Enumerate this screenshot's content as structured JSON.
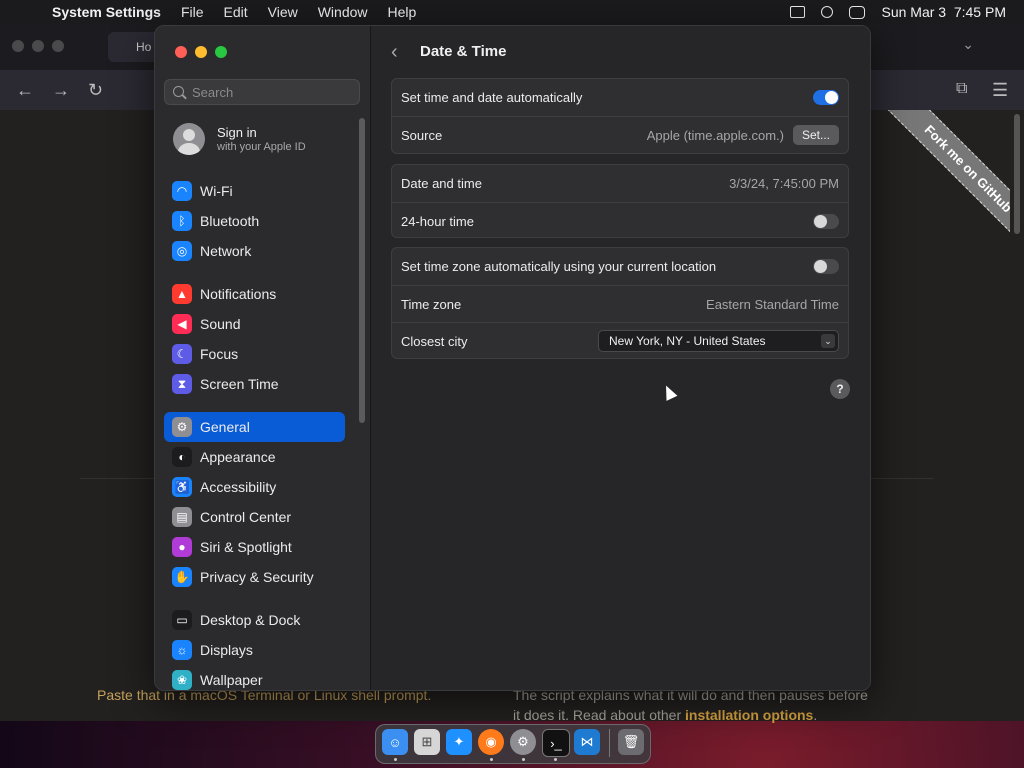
{
  "menubar": {
    "app": "System Settings",
    "items": [
      "File",
      "Edit",
      "View",
      "Window",
      "Help"
    ],
    "clock": "Sun Mar 3  7:45 PM"
  },
  "browser": {
    "tab_label": "Ho",
    "footer_left": "Paste that in a macOS Terminal or Linux shell prompt.",
    "footer_right_1": "The script explains what it will do and then pauses before",
    "footer_right_2a": "it does it. Read about other ",
    "footer_right_2b": "installation options",
    "footer_right_2c": ".",
    "ribbon": "Fork me on GitHub"
  },
  "sidebar": {
    "search_placeholder": "Search",
    "signin_title": "Sign in",
    "signin_sub": "with your Apple ID",
    "items": [
      {
        "label": "Wi-Fi",
        "icon": "wifi-icon",
        "color": "#1a84ff",
        "glyph": "◠"
      },
      {
        "label": "Bluetooth",
        "icon": "bluetooth-icon",
        "color": "#1a84ff",
        "glyph": "ᛒ"
      },
      {
        "label": "Network",
        "icon": "network-globe-icon",
        "color": "#1a84ff",
        "glyph": "◎"
      },
      {
        "label": "Notifications",
        "icon": "notifications-icon",
        "color": "#ff3b30",
        "glyph": "▲"
      },
      {
        "label": "Sound",
        "icon": "sound-icon",
        "color": "#ff2d55",
        "glyph": "◀"
      },
      {
        "label": "Focus",
        "icon": "focus-moon-icon",
        "color": "#5e5ce6",
        "glyph": "☾"
      },
      {
        "label": "Screen Time",
        "icon": "hourglass-icon",
        "color": "#5e5ce6",
        "glyph": "⧗"
      },
      {
        "label": "General",
        "icon": "gear-icon",
        "color": "#8e8e93",
        "glyph": "⚙"
      },
      {
        "label": "Appearance",
        "icon": "appearance-icon",
        "color": "#1c1c1e",
        "glyph": "◐"
      },
      {
        "label": "Accessibility",
        "icon": "accessibility-icon",
        "color": "#1a84ff",
        "glyph": "♿"
      },
      {
        "label": "Control Center",
        "icon": "control-center-icon",
        "color": "#8e8e93",
        "glyph": "▤"
      },
      {
        "label": "Siri & Spotlight",
        "icon": "siri-icon",
        "color": "#b03bd6",
        "glyph": "●"
      },
      {
        "label": "Privacy & Security",
        "icon": "privacy-hand-icon",
        "color": "#1a84ff",
        "glyph": "✋"
      },
      {
        "label": "Desktop & Dock",
        "icon": "desktop-dock-icon",
        "color": "#1c1c1e",
        "glyph": "▭"
      },
      {
        "label": "Displays",
        "icon": "displays-icon",
        "color": "#1a84ff",
        "glyph": "☼"
      },
      {
        "label": "Wallpaper",
        "icon": "wallpaper-icon",
        "color": "#30b0c7",
        "glyph": "❀"
      }
    ]
  },
  "page": {
    "title": "Date & Time",
    "set_auto_label": "Set time and date automatically",
    "source_label": "Source",
    "source_value": "Apple (time.apple.com.)",
    "set_button": "Set...",
    "date_time_label": "Date and time",
    "date_time_value": "3/3/24, 7:45:00 PM",
    "hour24_label": "24-hour time",
    "tz_auto_label": "Set time zone automatically using your current location",
    "tz_label": "Time zone",
    "tz_value": "Eastern Standard Time",
    "city_label": "Closest city",
    "city_value": "New York, NY - United States",
    "help": "?"
  },
  "toggles": {
    "set_auto": true,
    "hour24": false,
    "tz_auto": false
  },
  "dock": [
    "Finder",
    "Launchpad",
    "Safari",
    "Firefox",
    "System Settings",
    "Terminal",
    "VS Code",
    "Trash"
  ]
}
